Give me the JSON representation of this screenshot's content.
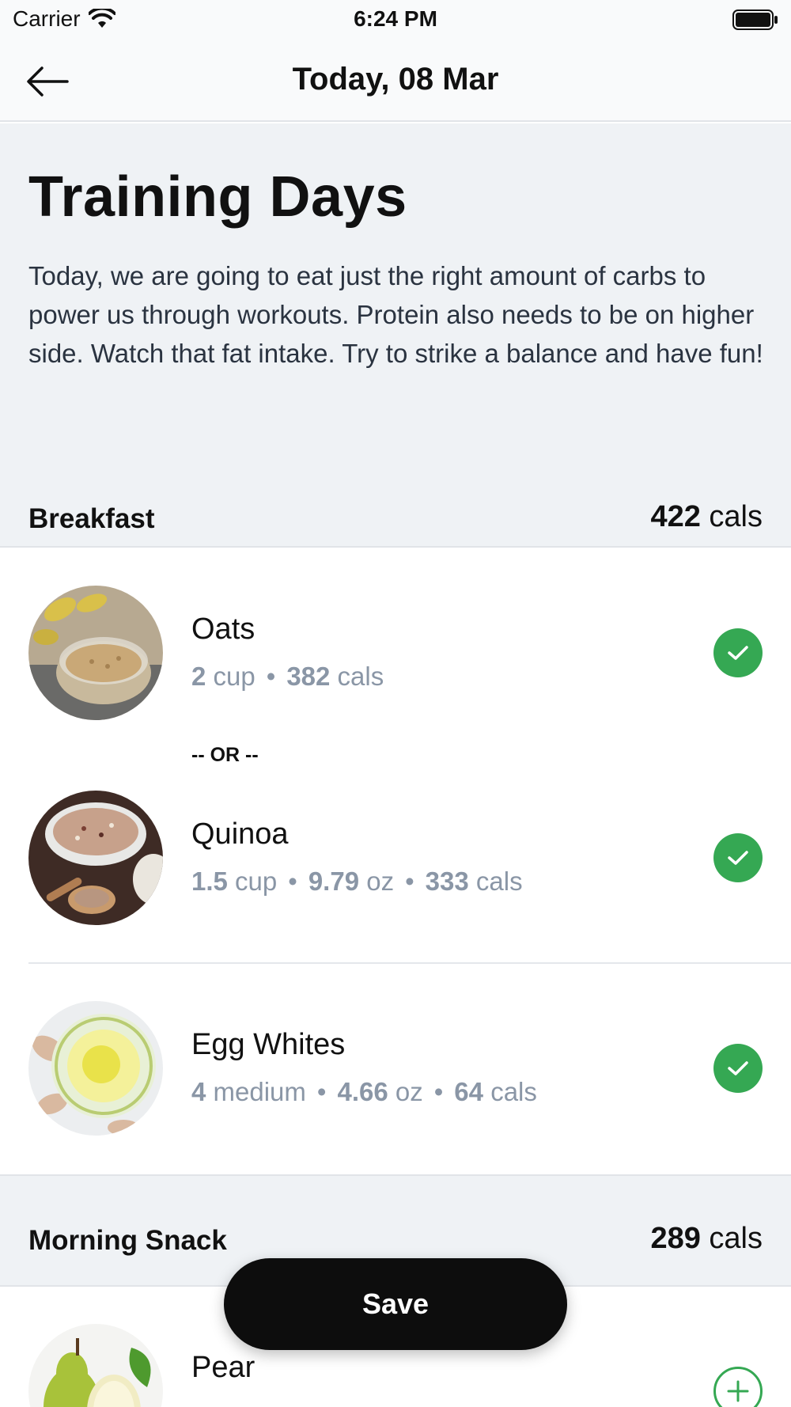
{
  "status_bar": {
    "carrier": "Carrier",
    "time": "6:24 PM"
  },
  "nav": {
    "title": "Today, 08 Mar"
  },
  "intro": {
    "heading": "Training Days",
    "description": "Today, we are going to eat just the right amount of carbs to power us through workouts. Protein also needs to be on higher side. Watch that fat intake. Try to strike a balance and have fun!"
  },
  "sections": [
    {
      "title": "Breakfast",
      "cals_value": "422",
      "cals_unit": "cals",
      "items": [
        {
          "name": "Oats",
          "qty_value": "2",
          "qty_unit": "cup",
          "cal_value": "382",
          "cal_unit": "cals",
          "status": "checked"
        },
        {
          "name": "Quinoa",
          "qty_value": "1.5",
          "qty_unit": "cup",
          "weight_value": "9.79",
          "weight_unit": "oz",
          "cal_value": "333",
          "cal_unit": "cals",
          "status": "checked"
        },
        {
          "name": "Egg Whites",
          "qty_value": "4",
          "qty_unit": "medium",
          "weight_value": "4.66",
          "weight_unit": "oz",
          "cal_value": "64",
          "cal_unit": "cals",
          "status": "checked"
        }
      ],
      "or_label": "-- OR --"
    },
    {
      "title": "Morning Snack",
      "cals_value": "289",
      "cals_unit": "cals",
      "items": [
        {
          "name": "Pear",
          "status": "add"
        }
      ]
    }
  ],
  "save_label": "Save",
  "colors": {
    "accent_green": "#35a853",
    "section_bg": "#eff2f5",
    "meta_text": "#8a96a6",
    "button_bg": "#0d0d0d"
  },
  "icons": [
    "wifi-icon",
    "battery-icon",
    "back-arrow-icon",
    "check-icon",
    "plus-icon"
  ]
}
